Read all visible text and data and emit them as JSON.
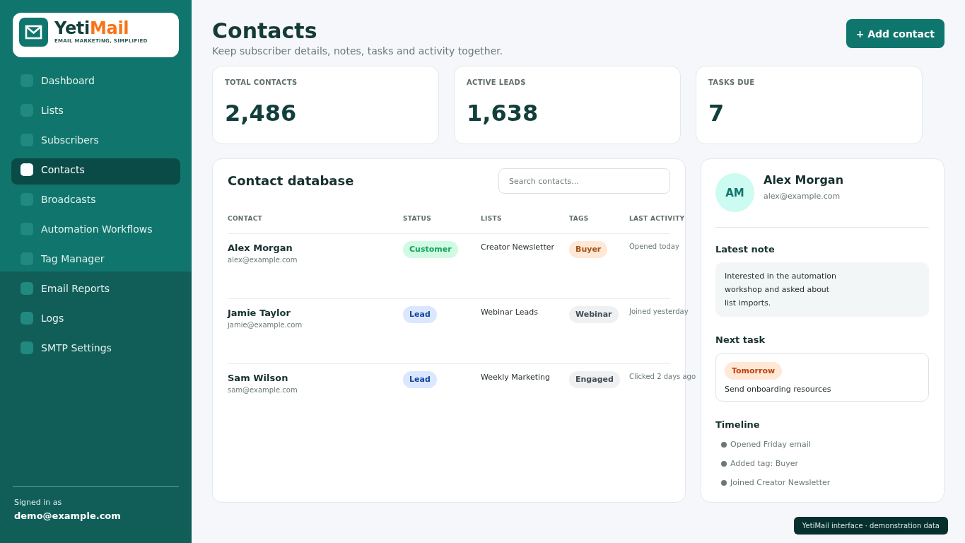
{
  "sidebar": {
    "brand": {
      "name": "Yeti**Mail**",
      "tagline": "EMAIL MARKETING, SIMPLIFIED"
    },
    "nav_items": [
      {
        "label": "Dashboard",
        "selected": false
      },
      {
        "label": "Lists",
        "selected": false
      },
      {
        "label": "Subscribers",
        "selected": false
      },
      {
        "label": "Contacts",
        "selected": true
      },
      {
        "label": "Broadcasts",
        "selected": false
      },
      {
        "label": "Automation Workflows",
        "selected": false
      },
      {
        "label": "Tag Manager",
        "selected": false
      },
      {
        "label": "Email Reports",
        "selected": false
      },
      {
        "label": "Logs",
        "selected": false
      },
      {
        "label": "SMTP Settings",
        "selected": false
      }
    ],
    "account": {
      "caption": "Signed in as",
      "email": "demo@example.com"
    }
  },
  "header": {
    "title": "Contacts",
    "subtitle": "Keep subscriber details, notes, tasks and activity together.",
    "primary_button": "+ Add contact"
  },
  "stats": [
    {
      "label": "TOTAL CONTACTS",
      "value": "2,486"
    },
    {
      "label": "ACTIVE LEADS",
      "value": "1,638"
    },
    {
      "label": "TASKS DUE",
      "value": "7"
    }
  ],
  "contact_table": {
    "title": "Contact database",
    "search": {
      "placeholder": "Search contacts..."
    },
    "columns": [
      "CONTACT",
      "STATUS",
      "LISTS",
      "TAGS",
      "LAST ACTIVITY"
    ],
    "rows": [
      {
        "name": "Alex Morgan",
        "email": "alex@example.com",
        "status": {
          "label": "Customer",
          "color": "#d1fae5"
        },
        "list": "Creator Newsletter",
        "tag": {
          "label": "Buyer",
          "color": "#ffe8d6"
        },
        "last_activity": "Opened today"
      },
      {
        "name": "Jamie Taylor",
        "email": "jamie@example.com",
        "status": {
          "label": "Lead",
          "color": "#dbe7fe"
        },
        "list": "Webinar Leads",
        "tag": {
          "label": "Webinar",
          "color": "#eef0f2"
        },
        "last_activity": "Joined yesterday"
      },
      {
        "name": "Sam Wilson",
        "email": "sam@example.com",
        "status": {
          "label": "Lead",
          "color": "#dbe7fe"
        },
        "list": "Weekly Marketing",
        "tag": {
          "label": "Engaged",
          "color": "#eef0f2"
        },
        "last_activity": "Clicked 2 days ago"
      }
    ]
  },
  "contact_detail": {
    "initials": "AM",
    "name": "Alex Morgan",
    "email": "alex@example.com",
    "note_heading": "Latest note",
    "note": "Interested in the automation workshop and asked about list imports.",
    "task_heading": "Next task",
    "task": {
      "due": "Tomorrow",
      "text": "Send onboarding resources"
    },
    "timeline_heading": "Timeline",
    "timeline": [
      "Opened Friday email",
      "Added tag: Buyer",
      "Joined Creator Newsletter"
    ]
  },
  "footer_note": "YetiMail interface · demonstration data"
}
